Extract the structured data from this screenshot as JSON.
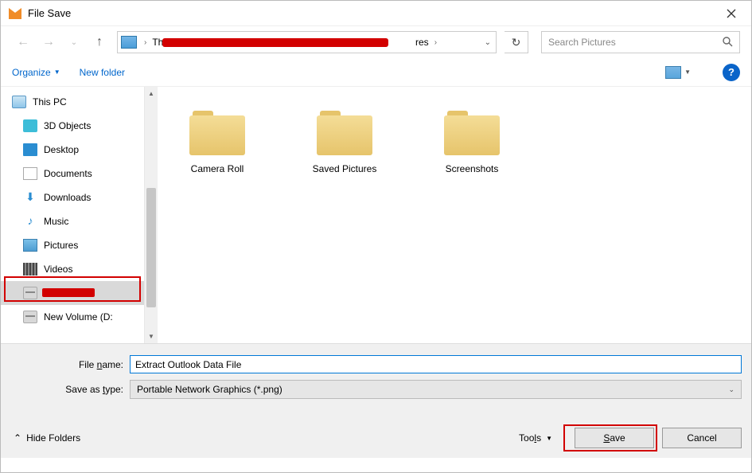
{
  "window": {
    "title": "File Save"
  },
  "address": {
    "root": "This",
    "tail": "res"
  },
  "search": {
    "placeholder": "Search Pictures"
  },
  "toolbar": {
    "organize": "Organize",
    "newfolder": "New folder"
  },
  "navtree": {
    "thispc": "This PC",
    "objects3d": "3D Objects",
    "desktop": "Desktop",
    "documents": "Documents",
    "downloads": "Downloads",
    "music": "Music",
    "pictures": "Pictures",
    "videos": "Videos",
    "newvolume": "New Volume (D:"
  },
  "folders": {
    "item1": "Camera Roll",
    "item2": "Saved Pictures",
    "item3": "Screenshots"
  },
  "form": {
    "filename_label": "File name:",
    "filename_value": "Extract Outlook Data File",
    "saveastype_label": "Save as type:",
    "saveastype_value": "Portable Network Graphics (*.png)"
  },
  "actions": {
    "hidefolders": "Hide Folders",
    "tools": "Tools",
    "save_prefix": "S",
    "save_rest": "ave",
    "cancel": "Cancel"
  }
}
